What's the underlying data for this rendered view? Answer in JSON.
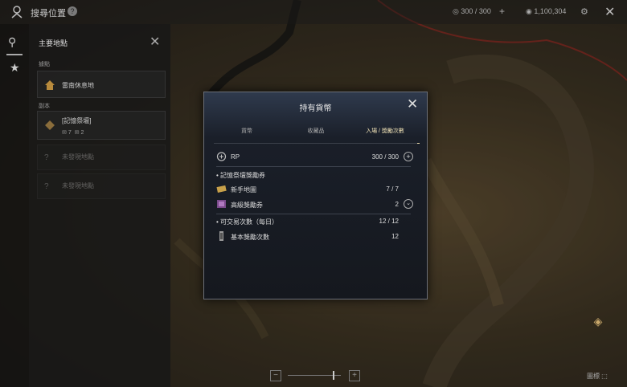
{
  "topbar": {
    "title": "搜尋位置",
    "help": "?",
    "rp_value": "300 / 300",
    "plus": "+",
    "gold_value": "1,100,304"
  },
  "sidepanel": {
    "title": "主要地點",
    "section_1": "據點",
    "rest_area": "雷南休息地",
    "section_2": "副本",
    "dungeon_name": "[記憶祭壇]",
    "dungeon_count_1": "7",
    "dungeon_count_2": "2",
    "undiscovered_1": "未發現地點",
    "undiscovered_2": "未發現地點"
  },
  "bottom": {
    "legend": "圖標",
    "zoom_level": 0.85
  },
  "modal": {
    "title": "持有貨幣",
    "tabs": [
      "貨幣",
      "收藏品",
      "入場 / 獎勵次數"
    ],
    "rp_label": "RP",
    "rp_value": "300 / 300",
    "group_1": "記憶祭壇獎勵券",
    "beginner_label": "新手地圖",
    "beginner_value": "7 / 7",
    "advanced_label": "高級獎勵券",
    "advanced_value": "2",
    "group_2": "可交易次數（每日）",
    "group_2_value": "12 / 12",
    "basic_label": "基本獎勵次數",
    "basic_value": "12"
  },
  "colors": {
    "accent": "#e6d7a8",
    "modal_top": "#2f3a4d"
  }
}
